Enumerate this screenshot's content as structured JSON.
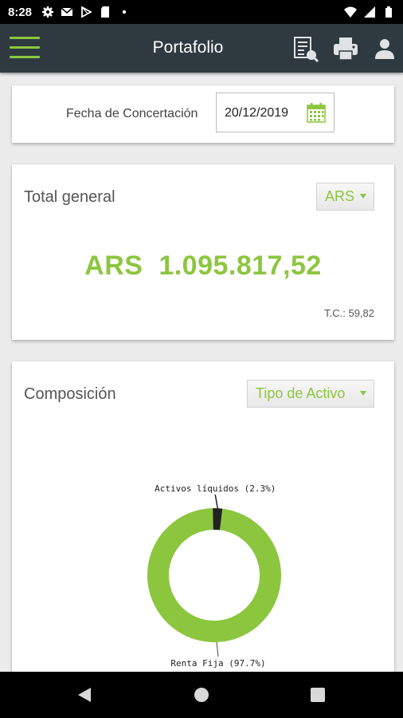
{
  "status_bar": {
    "time": "8:28",
    "left_icons": [
      "gear-icon",
      "gmail-icon",
      "play-store-icon",
      "sd-card-icon",
      "dot-icon"
    ],
    "right_icons": [
      "wifi-icon",
      "signal-icon",
      "battery-icon"
    ]
  },
  "app_bar": {
    "title": "Portafolio",
    "icons": [
      "menu-icon",
      "report-icon",
      "print-icon",
      "user-icon"
    ]
  },
  "fecha": {
    "label": "Fecha de Concertación",
    "value": "20/12/2019"
  },
  "total": {
    "title": "Total general",
    "currency_selected": "ARS",
    "value": "ARS  1.095.817,52",
    "exchange_rate": "T.C.: 59,82"
  },
  "composicion": {
    "title": "Composición",
    "group_by_selected": "Tipo de Activo"
  },
  "colors": {
    "accent": "#8cc63f",
    "appbar": "#2f3a40",
    "slice_dark": "#222222"
  },
  "chart_data": {
    "type": "pie",
    "categories": [
      "Renta Fija",
      "Activos líquidos"
    ],
    "values": [
      97.7,
      2.3
    ],
    "labels": [
      "Renta Fija (97.7%)",
      "Activos líquidos (2.3%)"
    ],
    "colors": [
      "#8cc63f",
      "#222222"
    ],
    "donut": true
  }
}
